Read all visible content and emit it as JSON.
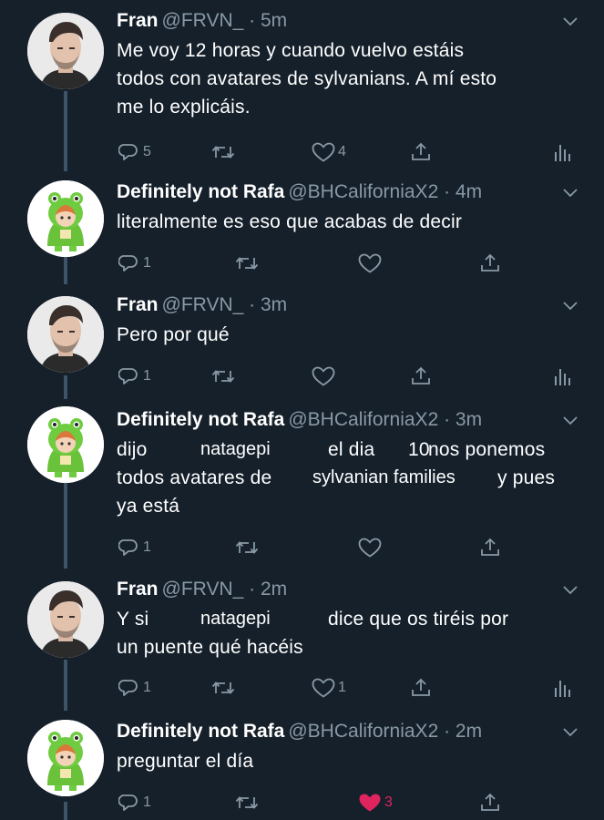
{
  "tweets": [
    {
      "name": "Fran",
      "handle": "@FRVN_",
      "time": "5m",
      "avatar": "man-photo",
      "lines": [
        [
          "Me voy 12 horas y cuando vuelvo estáis"
        ],
        [
          "todos con avatares de ",
          "sylvanians.",
          " A mí esto"
        ],
        [
          "me lo explicáis."
        ]
      ],
      "replies": "5",
      "retweets": "",
      "likes": "4",
      "liked": false
    },
    {
      "name": "Definitely not Rafa",
      "handle": "@BHCaliforniaX2",
      "time": "4m",
      "avatar": "sylvanian-frog",
      "lines": [
        [
          "literalmente es eso que acabas de decir"
        ]
      ],
      "replies": "1",
      "retweets": "",
      "likes": "",
      "liked": false
    },
    {
      "name": "Fran",
      "handle": "@FRVN_",
      "time": "3m",
      "avatar": "man-photo",
      "lines": [
        [
          "Pero por qué"
        ]
      ],
      "replies": "1",
      "retweets": "",
      "likes": "",
      "liked": false
    },
    {
      "name": "Definitely not Rafa",
      "handle": "@BHCaliforniaX2",
      "time": "3m",
      "avatar": "sylvanian-frog",
      "lines": [
        [
          "dijo",
          "natagepi",
          "el dia",
          "10",
          " nos ponemos"
        ],
        [
          "todos avatares de",
          "sylvanian families",
          "y pues"
        ],
        [
          "ya está"
        ]
      ],
      "replies": "1",
      "retweets": "",
      "likes": "",
      "liked": false
    },
    {
      "name": "Fran",
      "handle": "@FRVN_",
      "time": "2m",
      "avatar": "man-photo",
      "lines": [
        [
          "Y si",
          "natagepi",
          "dice que os tiréis por"
        ],
        [
          "un puente qué hacéis"
        ]
      ],
      "replies": "1",
      "retweets": "",
      "likes": "1",
      "liked": false
    },
    {
      "name": "Definitely not Rafa",
      "handle": "@BHCaliforniaX2",
      "time": "2m",
      "avatar": "sylvanian-frog",
      "lines": [
        [
          "preguntar el día"
        ]
      ],
      "replies": "1",
      "retweets": "",
      "likes": "3",
      "liked": true
    }
  ],
  "time_separator": " · ",
  "icons": {
    "reply": "reply-icon",
    "retweet": "retweet-icon",
    "like": "heart-icon",
    "share": "share-icon",
    "analytics": "analytics-icon",
    "caret": "chevron-down-icon"
  },
  "colors": {
    "background": "#15202b",
    "secondary_text": "#8899a6",
    "thread_line": "#3d5466",
    "like_active": "#e0245e"
  }
}
